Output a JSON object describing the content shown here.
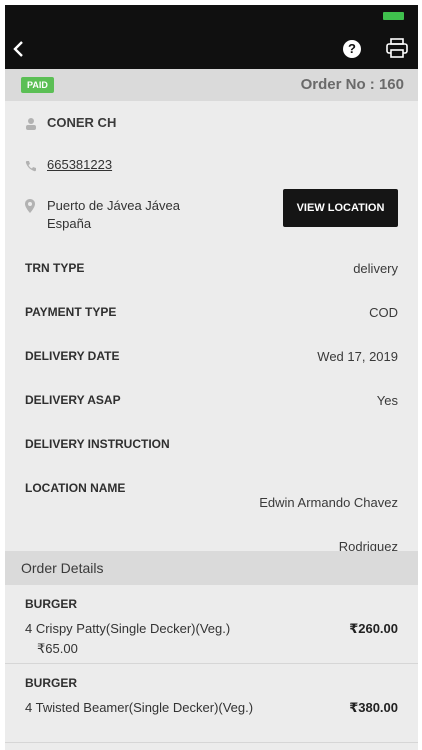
{
  "toolbar": {
    "back_icon": "chevron-left-icon",
    "help_icon": "help-circle-icon",
    "help_label": "?",
    "print_icon": "printer-icon"
  },
  "order": {
    "status_badge": "PAID",
    "order_no": "Order No : 160"
  },
  "customer": {
    "name": "CONER CH",
    "phone": "665381223",
    "address": "Puerto de Jávea Jávea España",
    "view_location_label": "VIEW LOCATION"
  },
  "details": [
    {
      "key": "TRN TYPE",
      "value": "delivery"
    },
    {
      "key": "PAYMENT TYPE",
      "value": "COD"
    },
    {
      "key": "DELIVERY DATE",
      "value": "Wed 17, 2019"
    },
    {
      "key": "DELIVERY ASAP",
      "value": "Yes"
    },
    {
      "key": "DELIVERY INSTRUCTION",
      "value": ""
    }
  ],
  "location_name": {
    "key": "LOCATION NAME",
    "value": "Edwin Armando Chavez Rodriguez"
  },
  "order_details": {
    "title": "Order Details",
    "items": [
      {
        "category": "BURGER",
        "name": "4 Crispy Patty(Single Decker)(Veg.)",
        "unit_price": "₹65.00",
        "price": "₹260.00"
      },
      {
        "category": "BURGER",
        "name": "4 Twisted Beamer(Single Decker)(Veg.)",
        "unit_price": "",
        "price": "₹380.00"
      }
    ]
  },
  "colors": {
    "toolbar": "#101010",
    "paid_badge": "#5bbf55",
    "battery": "#3fc04d",
    "background": "#ececec",
    "section": "#dadada"
  }
}
